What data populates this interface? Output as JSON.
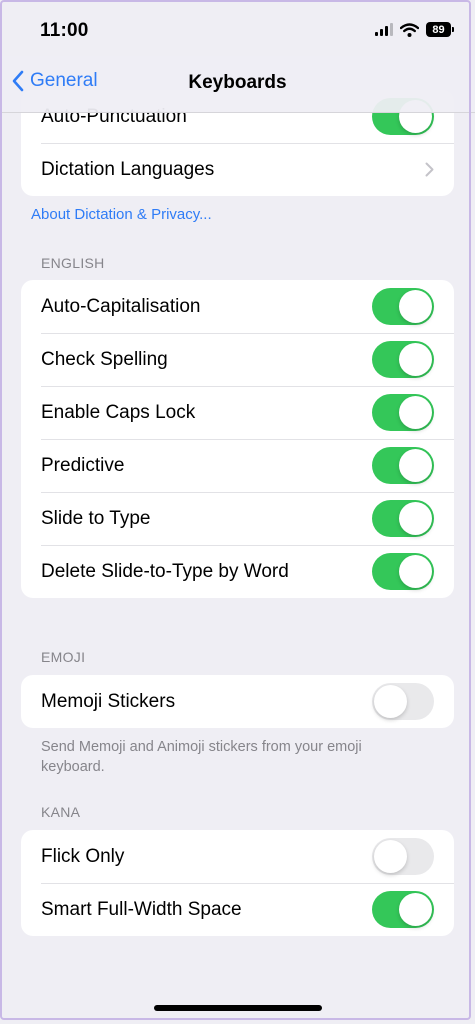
{
  "status_bar": {
    "time": "11:00",
    "battery": "89"
  },
  "nav": {
    "back_label": "General",
    "title": "Keyboards"
  },
  "top_group": {
    "rows": [
      {
        "label": "Auto-Punctuation",
        "on": true
      },
      {
        "label": "Dictation Languages"
      }
    ]
  },
  "dictation_link": "About Dictation & Privacy...",
  "english": {
    "header": "ENGLISH",
    "rows": [
      {
        "label": "Auto-Capitalisation",
        "on": true
      },
      {
        "label": "Check Spelling",
        "on": true
      },
      {
        "label": "Enable Caps Lock",
        "on": true
      },
      {
        "label": "Predictive",
        "on": true
      },
      {
        "label": "Slide to Type",
        "on": true
      },
      {
        "label": "Delete Slide-to-Type by Word",
        "on": true
      }
    ]
  },
  "emoji": {
    "header": "EMOJI",
    "rows": [
      {
        "label": "Memoji Stickers",
        "on": false
      }
    ],
    "footnote": "Send Memoji and Animoji stickers from your emoji keyboard."
  },
  "kana": {
    "header": "KANA",
    "rows": [
      {
        "label": "Flick Only",
        "on": false
      },
      {
        "label": "Smart Full-Width Space",
        "on": true
      }
    ]
  },
  "colors": {
    "accent": "#2f7cf6",
    "toggle_on": "#34c759",
    "toggle_off": "#e9e9eb",
    "background": "#efeef4"
  },
  "icons": {
    "back": "chevron-left-icon",
    "disclosure": "chevron-right-icon",
    "signal": "cellular-signal-icon",
    "wifi": "wifi-icon",
    "battery": "battery-icon"
  }
}
